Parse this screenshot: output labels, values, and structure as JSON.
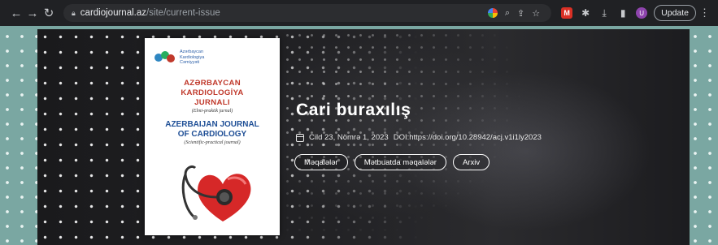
{
  "browser": {
    "url_host": "cardiojournal.az",
    "url_path": "/site/current-issue",
    "update_label": "Update",
    "avatar_letter": "U",
    "icons": [
      "back-icon",
      "forward-icon",
      "reload-icon",
      "lock-icon",
      "google-lens-icon",
      "search-icon",
      "share-icon",
      "bookmark-star-icon",
      "extension-icon",
      "puzzle-icon",
      "download-icon",
      "sidebar-icon",
      "avatar",
      "kebab-menu-icon"
    ]
  },
  "cover": {
    "society_line1": "Azərbaycan",
    "society_line2": "Kardiologiya",
    "society_line3": "Cəmiyyəti",
    "title_az_1": "AZƏRBAYCAN KARDIOLOGİYA",
    "title_az_2": "JURNALI",
    "subtitle_az": "(Elmi-praktik jurnal)",
    "title_en_1": "AZERBAIJAN JOURNAL",
    "title_en_2": "OF CARDIOLOGY",
    "subtitle_en": "(Scientific-practical journal)"
  },
  "hero": {
    "title": "Cari buraxılış",
    "issue": "Cild 23, Nömrə 1, 2023",
    "doi": "DOI:https://doi.org/10.28942/acj.v1i1ly2023",
    "buttons": [
      "Məqalələr",
      "Mətbuatda məqalələr",
      "Arxiv"
    ]
  },
  "colors": {
    "accent_red": "#c0392b",
    "accent_blue": "#1f4f96",
    "page_teal": "#7aa7a2"
  }
}
